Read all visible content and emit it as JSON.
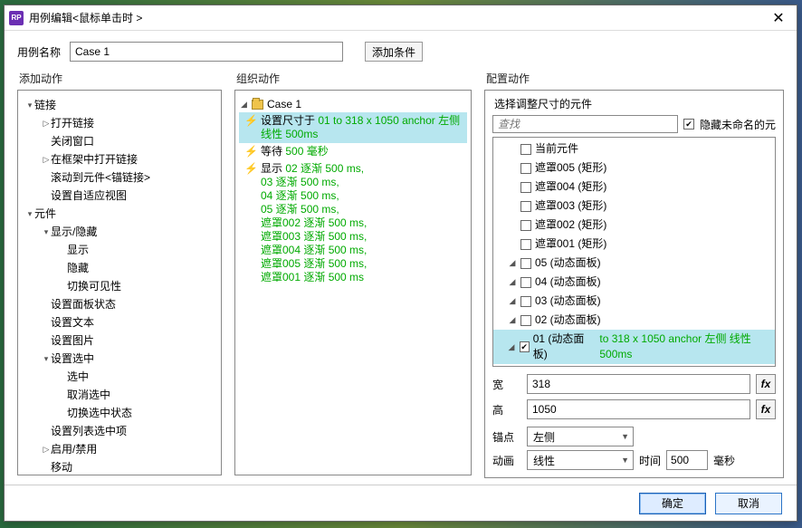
{
  "title": "用例编辑<鼠标单击时 >",
  "caseName": {
    "label": "用例名称",
    "value": "Case 1"
  },
  "addCondition": "添加条件",
  "columns": {
    "add": "添加动作",
    "organize": "组织动作",
    "configure": "配置动作"
  },
  "addTree": [
    {
      "depth": 0,
      "arrow": "▾",
      "label": "链接"
    },
    {
      "depth": 1,
      "arrow": "▷",
      "label": "打开链接"
    },
    {
      "depth": 1,
      "arrow": "",
      "label": "关闭窗口"
    },
    {
      "depth": 1,
      "arrow": "▷",
      "label": "在框架中打开链接"
    },
    {
      "depth": 1,
      "arrow": "",
      "label": "滚动到元件<锚链接>"
    },
    {
      "depth": 1,
      "arrow": "",
      "label": "设置自适应视图"
    },
    {
      "depth": 0,
      "arrow": "▾",
      "label": "元件"
    },
    {
      "depth": 1,
      "arrow": "▾",
      "label": "显示/隐藏"
    },
    {
      "depth": 2,
      "arrow": "",
      "label": "显示"
    },
    {
      "depth": 2,
      "arrow": "",
      "label": "隐藏"
    },
    {
      "depth": 2,
      "arrow": "",
      "label": "切换可见性"
    },
    {
      "depth": 1,
      "arrow": "",
      "label": "设置面板状态"
    },
    {
      "depth": 1,
      "arrow": "",
      "label": "设置文本"
    },
    {
      "depth": 1,
      "arrow": "",
      "label": "设置图片"
    },
    {
      "depth": 1,
      "arrow": "▾",
      "label": "设置选中"
    },
    {
      "depth": 2,
      "arrow": "",
      "label": "选中"
    },
    {
      "depth": 2,
      "arrow": "",
      "label": "取消选中"
    },
    {
      "depth": 2,
      "arrow": "",
      "label": "切换选中状态"
    },
    {
      "depth": 1,
      "arrow": "",
      "label": "设置列表选中项"
    },
    {
      "depth": 1,
      "arrow": "▷",
      "label": "启用/禁用"
    },
    {
      "depth": 1,
      "arrow": "",
      "label": "移动"
    }
  ],
  "orgCaseLabel": "Case 1",
  "orgActions": [
    {
      "selected": true,
      "label": "设置尺寸于 ",
      "detail": "01 to 318 x 1050 anchor 左侧 线性 500ms"
    },
    {
      "selected": false,
      "label": "等待 ",
      "detail": "500 毫秒"
    },
    {
      "selected": false,
      "label": "显示 ",
      "detail": "02 逐渐 500 ms,\n03 逐渐 500 ms,\n04 逐渐 500 ms,\n05 逐渐 500 ms,\n遮罩002 逐渐 500 ms,\n遮罩003 逐渐 500 ms,\n遮罩004 逐渐 500 ms,\n遮罩005 逐渐 500 ms,\n遮罩001 逐渐 500 ms"
    }
  ],
  "config": {
    "subtitle": "选择调整尺寸的元件",
    "searchPlaceholder": "查找",
    "hideUnnamed": {
      "label": "隐藏未命名的元",
      "checked": true
    },
    "widgets": [
      {
        "exp": "",
        "checked": false,
        "label": "当前元件"
      },
      {
        "exp": "",
        "checked": false,
        "label": "遮罩005 (矩形)"
      },
      {
        "exp": "",
        "checked": false,
        "label": "遮罩004 (矩形)"
      },
      {
        "exp": "",
        "checked": false,
        "label": "遮罩003 (矩形)"
      },
      {
        "exp": "",
        "checked": false,
        "label": "遮罩002 (矩形)"
      },
      {
        "exp": "",
        "checked": false,
        "label": "遮罩001 (矩形)"
      },
      {
        "exp": "◢",
        "checked": false,
        "label": "05 (动态面板)"
      },
      {
        "exp": "◢",
        "checked": false,
        "label": "04 (动态面板)"
      },
      {
        "exp": "◢",
        "checked": false,
        "label": "03 (动态面板)"
      },
      {
        "exp": "◢",
        "checked": false,
        "label": "02 (动态面板)"
      },
      {
        "exp": "◢",
        "checked": true,
        "label": "01 (动态面板)",
        "detail": " to 318 x 1050 anchor 左侧 线性 500ms",
        "selected": true
      }
    ],
    "width": {
      "label": "宽",
      "value": "318"
    },
    "height": {
      "label": "高",
      "value": "1050"
    },
    "anchor": {
      "label": "锚点",
      "value": "左侧"
    },
    "anim": {
      "label": "动画",
      "value": "线性",
      "timeLabel": "时间",
      "timeValue": "500",
      "unit": "毫秒"
    },
    "fx": "fx"
  },
  "footer": {
    "ok": "确定",
    "cancel": "取消"
  }
}
